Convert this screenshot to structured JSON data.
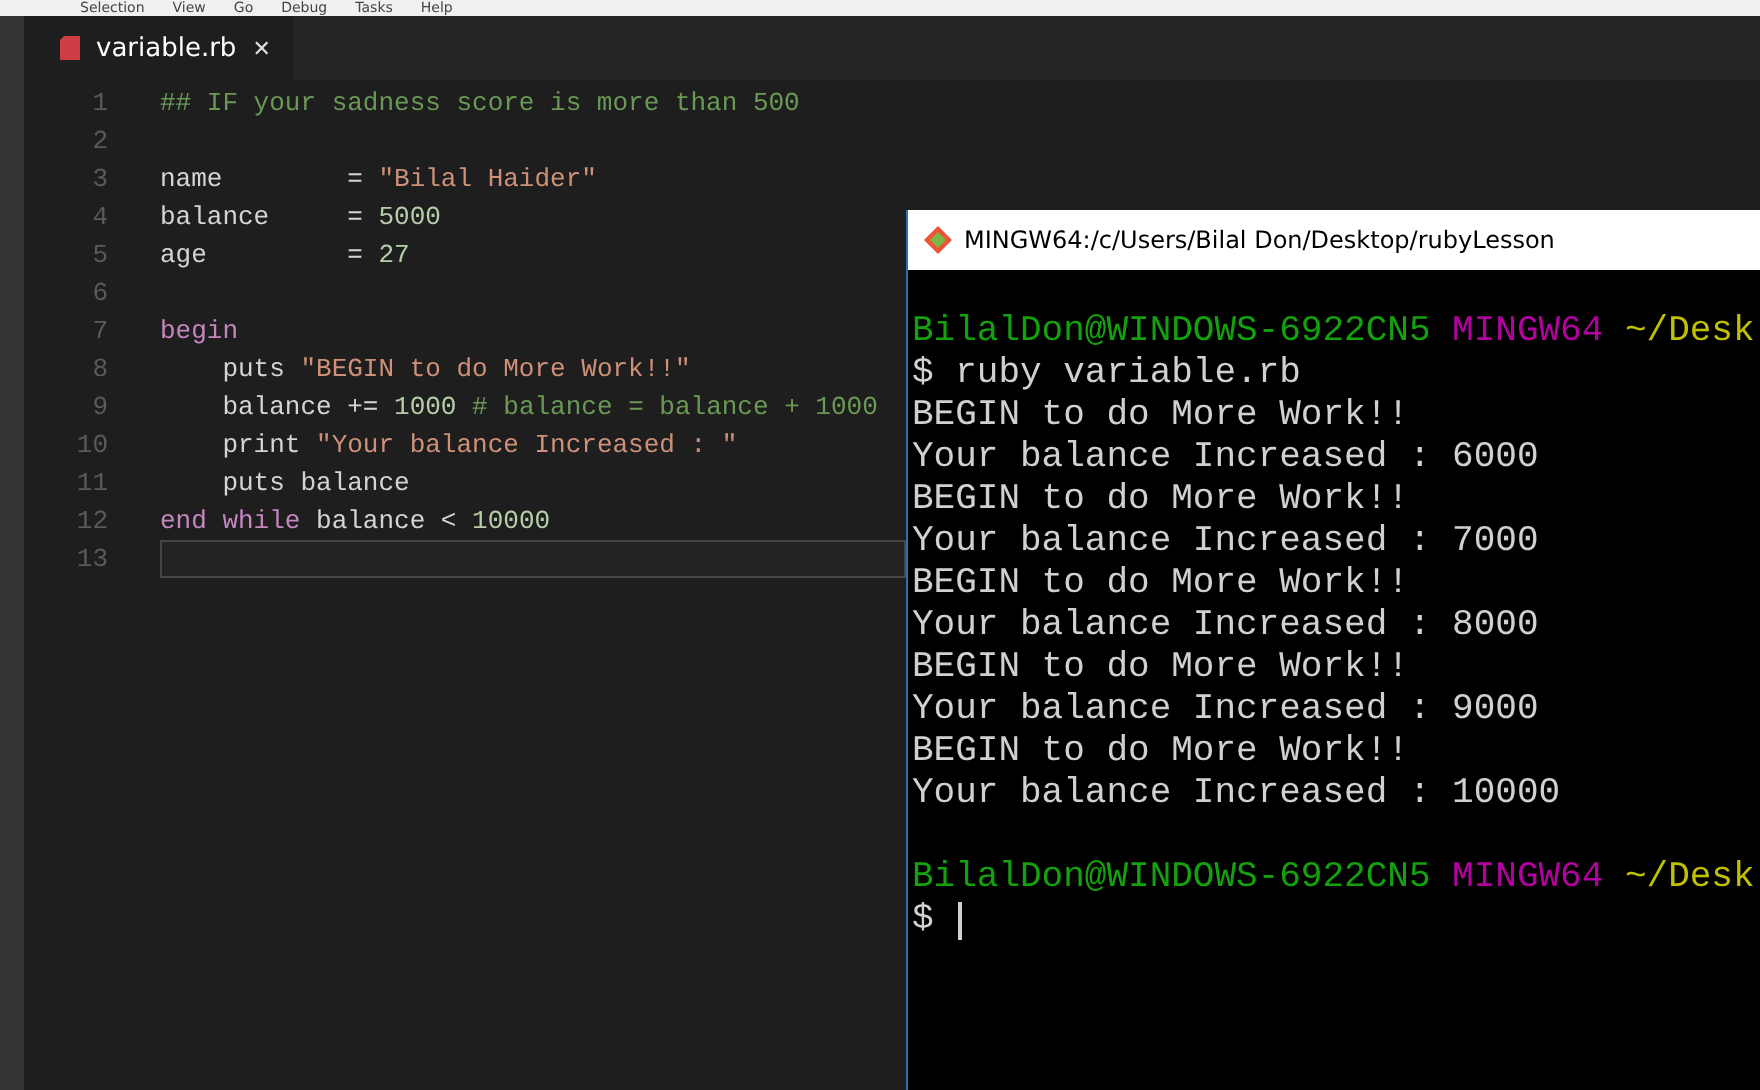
{
  "menu_bar": {
    "items": [
      "Selection",
      "View",
      "Go",
      "Debug",
      "Tasks",
      "Help"
    ]
  },
  "tabs": [
    {
      "label": "variable.rb",
      "selected": true,
      "close": "✕"
    }
  ],
  "editor": {
    "lines": [
      {
        "number": "1",
        "current": false,
        "tokens": [
          {
            "kind": "comment",
            "text": "## IF your sadness score is more than 500"
          }
        ]
      },
      {
        "number": "2",
        "current": false
      },
      {
        "number": "3",
        "current": false,
        "tokens": [
          {
            "kind": "plain",
            "text": "name        = "
          },
          {
            "kind": "string",
            "text": "\"Bilal Haider\""
          }
        ]
      },
      {
        "number": "4",
        "current": false,
        "tokens": [
          {
            "kind": "plain",
            "text": "balance     = "
          },
          {
            "kind": "number",
            "text": "5000"
          }
        ]
      },
      {
        "number": "5",
        "current": false,
        "tokens": [
          {
            "kind": "plain",
            "text": "age         = "
          },
          {
            "kind": "number",
            "text": "27"
          }
        ]
      },
      {
        "number": "6",
        "current": false
      },
      {
        "number": "7",
        "current": false,
        "tokens": [
          {
            "kind": "keyword",
            "text": "begin"
          }
        ]
      },
      {
        "number": "8",
        "current": false,
        "tokens": [
          {
            "kind": "plain",
            "text": "    puts "
          },
          {
            "kind": "string",
            "text": "\"BEGIN to do More Work!!\""
          }
        ]
      },
      {
        "number": "9",
        "current": false,
        "tokens": [
          {
            "kind": "plain",
            "text": "    balance += "
          },
          {
            "kind": "number",
            "text": "1000"
          },
          {
            "kind": "comment",
            "text": " # balance = balance + 1000"
          }
        ]
      },
      {
        "number": "10",
        "current": false,
        "tokens": [
          {
            "kind": "plain",
            "text": "    print "
          },
          {
            "kind": "string",
            "text": "\"Your balance Increased : \""
          }
        ]
      },
      {
        "number": "11",
        "current": false,
        "tokens": [
          {
            "kind": "plain",
            "text": "    puts balance"
          }
        ]
      },
      {
        "number": "12",
        "current": false,
        "tokens": [
          {
            "kind": "keyword",
            "text": "end"
          },
          {
            "kind": "keyword",
            "text": " while"
          },
          {
            "kind": "plain",
            "text": " balance < "
          },
          {
            "kind": "number",
            "text": "10000"
          }
        ]
      },
      {
        "number": "13",
        "current": true
      }
    ]
  },
  "terminal": {
    "title": "MINGW64:/c/Users/Bilal Don/Desktop/rubyLesson",
    "lines": [
      {
        "segments": [
          {
            "kind": "user",
            "text": "BilalDon@WINDOWS-6922CN5"
          },
          {
            "kind": "host",
            "text": " MINGW64"
          },
          {
            "kind": "path",
            "text": " ~/Desk"
          }
        ]
      },
      {
        "segments": [
          {
            "kind": "plain",
            "text": "$ ruby variable.rb"
          }
        ]
      },
      {
        "segments": [
          {
            "kind": "plain",
            "text": "BEGIN to do More Work!!"
          }
        ]
      },
      {
        "segments": [
          {
            "kind": "plain",
            "text": "Your balance Increased : 6000"
          }
        ]
      },
      {
        "segments": [
          {
            "kind": "plain",
            "text": "BEGIN to do More Work!!"
          }
        ]
      },
      {
        "segments": [
          {
            "kind": "plain",
            "text": "Your balance Increased : 7000"
          }
        ]
      },
      {
        "segments": [
          {
            "kind": "plain",
            "text": "BEGIN to do More Work!!"
          }
        ]
      },
      {
        "segments": [
          {
            "kind": "plain",
            "text": "Your balance Increased : 8000"
          }
        ]
      },
      {
        "segments": [
          {
            "kind": "plain",
            "text": "BEGIN to do More Work!!"
          }
        ]
      },
      {
        "segments": [
          {
            "kind": "plain",
            "text": "Your balance Increased : 9000"
          }
        ]
      },
      {
        "segments": [
          {
            "kind": "plain",
            "text": "BEGIN to do More Work!!"
          }
        ]
      },
      {
        "segments": [
          {
            "kind": "plain",
            "text": "Your balance Increased : 10000"
          }
        ]
      },
      {
        "gap_before": true,
        "segments": [
          {
            "kind": "user",
            "text": "BilalDon@WINDOWS-6922CN5"
          },
          {
            "kind": "host",
            "text": " MINGW64"
          },
          {
            "kind": "path",
            "text": " ~/Desk"
          }
        ]
      },
      {
        "segments": [
          {
            "kind": "plain",
            "text": "$"
          }
        ],
        "cursor": true
      }
    ]
  }
}
